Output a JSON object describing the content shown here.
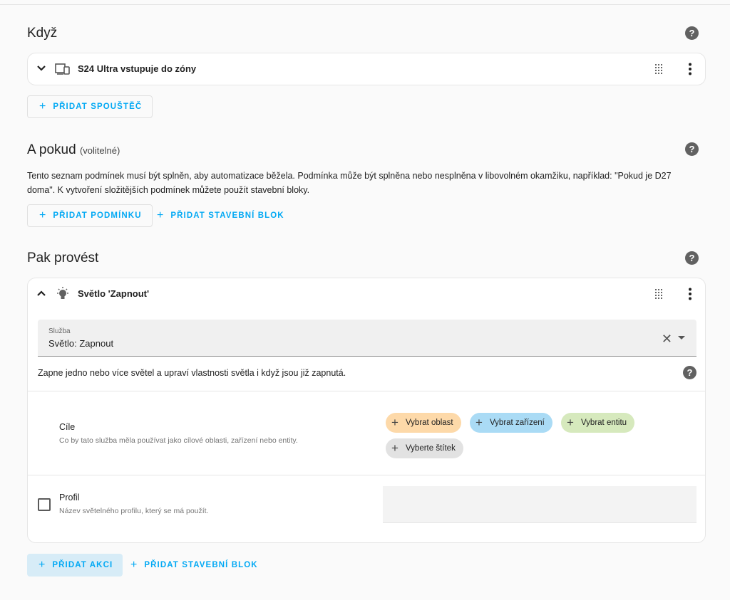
{
  "when": {
    "title": "Když",
    "trigger_title": "S24 Ultra vstupuje do zóny",
    "add_trigger_label": "PŘIDAT SPOUŠTĚČ"
  },
  "and_if": {
    "title": "A pokud",
    "subtitle": "(volitelné)",
    "description": "Tento seznam podmínek musí být splněn, aby automatizace běžela. Podmínka může být splněna nebo nesplněna v libovolném okamžiku, například: \"Pokud je D27 doma\". K vytvoření složitějších podmínek můžete použít stavební bloky.",
    "add_condition_label": "PŘIDAT PODMÍNKU",
    "add_building_block_label": "PŘIDAT STAVEBNÍ BLOK"
  },
  "then_do": {
    "title": "Pak provést",
    "action_title": "Světlo 'Zapnout'",
    "service_label": "Služba",
    "service_value": "Světlo: Zapnout",
    "service_description": "Zapne jedno nebo více světel a upraví vlastnosti světla i když jsou již zapnutá.",
    "targets_title": "Cíle",
    "targets_description": "Co by tato služba měla používat jako cílové oblasti, zařízení nebo entity.",
    "chips": {
      "area": "Vybrat oblast",
      "device": "Vybrat zařízení",
      "entity": "Vybrat entitu",
      "label": "Vyberte štítek"
    },
    "profile_title": "Profil",
    "profile_description": "Název světelného profilu, který se má použít.",
    "add_action_label": "PŘIDAT AKCI",
    "add_building_block_label": "PŘIDAT STAVEBNÍ BLOK"
  },
  "icons": {
    "help": "help-icon",
    "device": "device-icon",
    "bulb": "lightbulb-icon",
    "grip": "drag-handle-icon",
    "menu": "more-vertical-icon"
  },
  "colors": {
    "accent": "#03a9f4",
    "chip_area": "#fdd9a9",
    "chip_device": "#aadbf5",
    "chip_entity": "#d6e9bd",
    "chip_label": "#e2e2e2"
  }
}
